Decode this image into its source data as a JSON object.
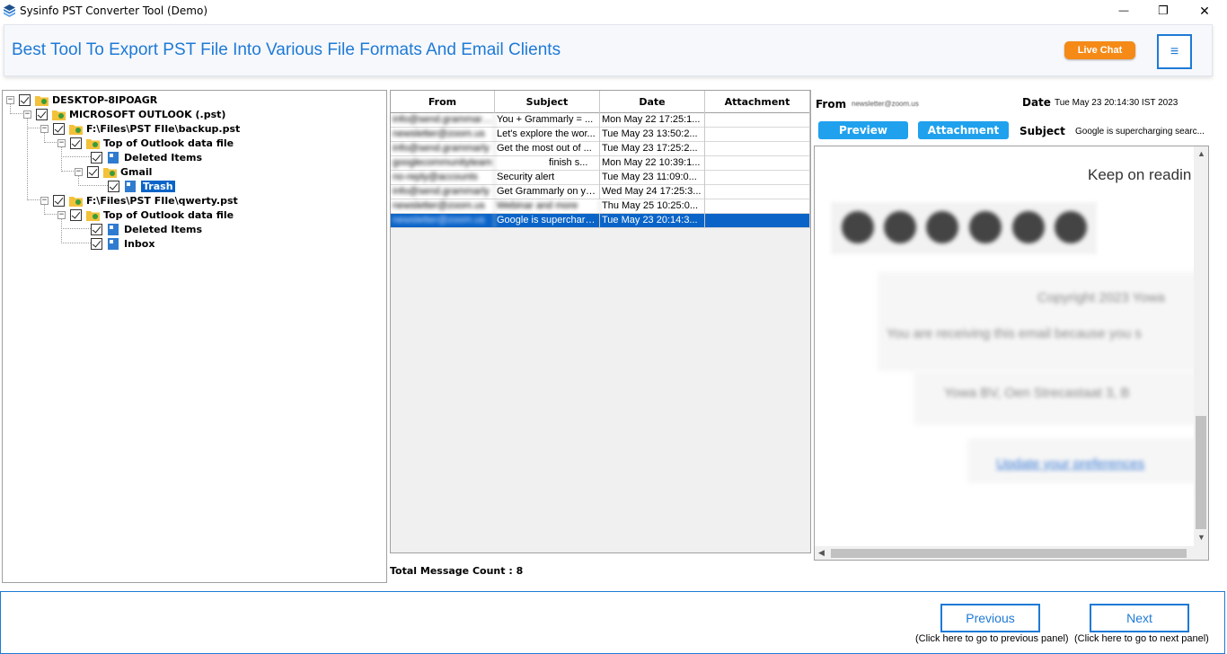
{
  "window": {
    "title": "Sysinfo PST Converter Tool (Demo)",
    "minimize_glyph": "—",
    "maximize_glyph": "❐",
    "close_glyph": "✕"
  },
  "header": {
    "headline": "Best Tool To Export PST File Into Various File Formats And Email Clients",
    "live_chat_label": "Live Chat",
    "menu_glyph": "≡"
  },
  "tree": {
    "nodes": [
      {
        "label": "DESKTOP-8IPOAGR",
        "icon": "computer-folder-icon"
      },
      {
        "label": "MICROSOFT OUTLOOK (.pst)",
        "icon": "outlook-folder-icon"
      },
      {
        "label": "F:\\Files\\PST FIle\\backup.pst",
        "icon": "pst-folder-icon"
      },
      {
        "label": "Top of Outlook data file",
        "icon": "folder-icon"
      },
      {
        "label": "Deleted Items",
        "icon": "mail-folder-icon"
      },
      {
        "label": "Gmail",
        "icon": "folder-icon"
      },
      {
        "label": "Trash",
        "icon": "mail-folder-icon"
      },
      {
        "label": "F:\\Files\\PST FIle\\qwerty.pst",
        "icon": "pst-folder-icon"
      },
      {
        "label": "Top of Outlook data file",
        "icon": "folder-icon"
      },
      {
        "label": "Deleted Items",
        "icon": "mail-folder-icon"
      },
      {
        "label": "Inbox",
        "icon": "mail-folder-icon"
      }
    ],
    "expander_glyph": "−"
  },
  "mail_list": {
    "columns": [
      "From",
      "Subject",
      "Date",
      "Attachment"
    ],
    "rows": [
      {
        "from": "info@send.grammarly.com",
        "subject": "You + Grammarly = ...",
        "date": "Mon May 22 17:25:1...",
        "attachment": ""
      },
      {
        "from": "newsletter@zoom.us",
        "subject": "Let's explore the wor...",
        "date": "Tue May 23 13:50:2...",
        "attachment": ""
      },
      {
        "from": "info@send.grammarly",
        "subject": "Get the most out of ...",
        "date": "Tue May 23 17:25:2...",
        "attachment": ""
      },
      {
        "from": "googlecommunityteam",
        "subject": "finish s...",
        "date": "Mon May 22 10:39:1...",
        "attachment": ""
      },
      {
        "from": "no-reply@accounts",
        "subject": "Security alert",
        "date": "Tue May 23 11:09:0...",
        "attachment": ""
      },
      {
        "from": "info@send.grammarly",
        "subject": "Get Grammarly on yo...",
        "date": "Wed May 24 17:25:3...",
        "attachment": ""
      },
      {
        "from": "newsletter@zoom.us",
        "subject": "Webinar and more",
        "date": "Thu May 25 10:25:0...",
        "attachment": ""
      },
      {
        "from": "newsletter@zoom.us",
        "subject": "Google is supercharging...",
        "date": "Tue May 23 20:14:3...",
        "attachment": ""
      }
    ],
    "total_label": "Total Message Count : 8"
  },
  "preview": {
    "from_label": "From",
    "from_value": "newsletter@zoom.us",
    "date_label": "Date",
    "date_value": "Tue May 23 20:14:30 IST 2023",
    "tab_preview": "Preview",
    "tab_attachment": "Attachment",
    "subject_label": "Subject",
    "subject_value": "Google is supercharging searc...",
    "body": {
      "keep_reading": "Keep on readin",
      "copyright": "Copyright 2023 Yowa",
      "receiving": "You are receiving this email because you s",
      "address": "Yowa BV, Oen Strecastaat 3, B",
      "update_link": "Update your preferences"
    },
    "scroll_up": "▲",
    "scroll_down": "▼",
    "scroll_left": "◀"
  },
  "footer": {
    "previous_label": "Previous",
    "previous_hint": "(Click here to go to previous panel)",
    "next_label": "Next",
    "next_hint": "(Click here to go to next panel)"
  }
}
